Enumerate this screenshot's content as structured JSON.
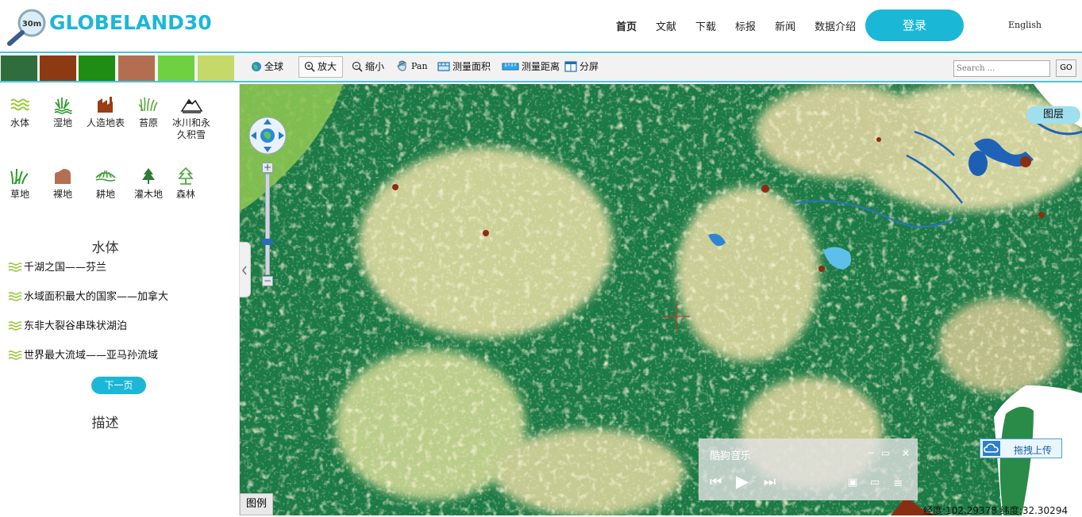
{
  "header": {
    "logo_badge": "30m",
    "logo_text": "GLOBELAND30",
    "nav": [
      "首页",
      "文献",
      "下载",
      "标报",
      "新闻",
      "数据介绍"
    ],
    "login": "登录",
    "language": "English"
  },
  "toolbar": {
    "swatch_colors": [
      "#2f6e3c",
      "#8b3a14",
      "#1f8c13",
      "#b36e52",
      "#6fd142",
      "#c4d96a"
    ],
    "tools": {
      "full_extent": "全球",
      "zoom_in": "放大",
      "zoom_out": "缩小",
      "pan": "Pan",
      "measure_area": "测量面积",
      "measure_distance": "测量距离",
      "split_screen": "分屏"
    },
    "search_placeholder": "Search ...",
    "go": "GO"
  },
  "sidebar": {
    "categories_row1": [
      "水体",
      "湿地",
      "人造地表",
      "苔原",
      "冰川和永久积雪"
    ],
    "categories_row2": [
      "草地",
      "裸地",
      "耕地",
      "灌木地",
      "森林"
    ],
    "section_title": "水体",
    "items": [
      "千湖之国——芬兰",
      "水域面积最大的国家——加拿大",
      "东非大裂谷串珠状湖泊",
      "世界最大流域——亚马孙流域"
    ],
    "next_page": "下一页",
    "description_title": "描述"
  },
  "map": {
    "layers_button": "图层",
    "upload_button": "拖拽上传",
    "music_title": "酷狗音乐",
    "legend_tab": "图例",
    "longitude_label": "经度:",
    "longitude": "102.29378",
    "latitude_label": "纬度:",
    "latitude": "32.30294"
  }
}
